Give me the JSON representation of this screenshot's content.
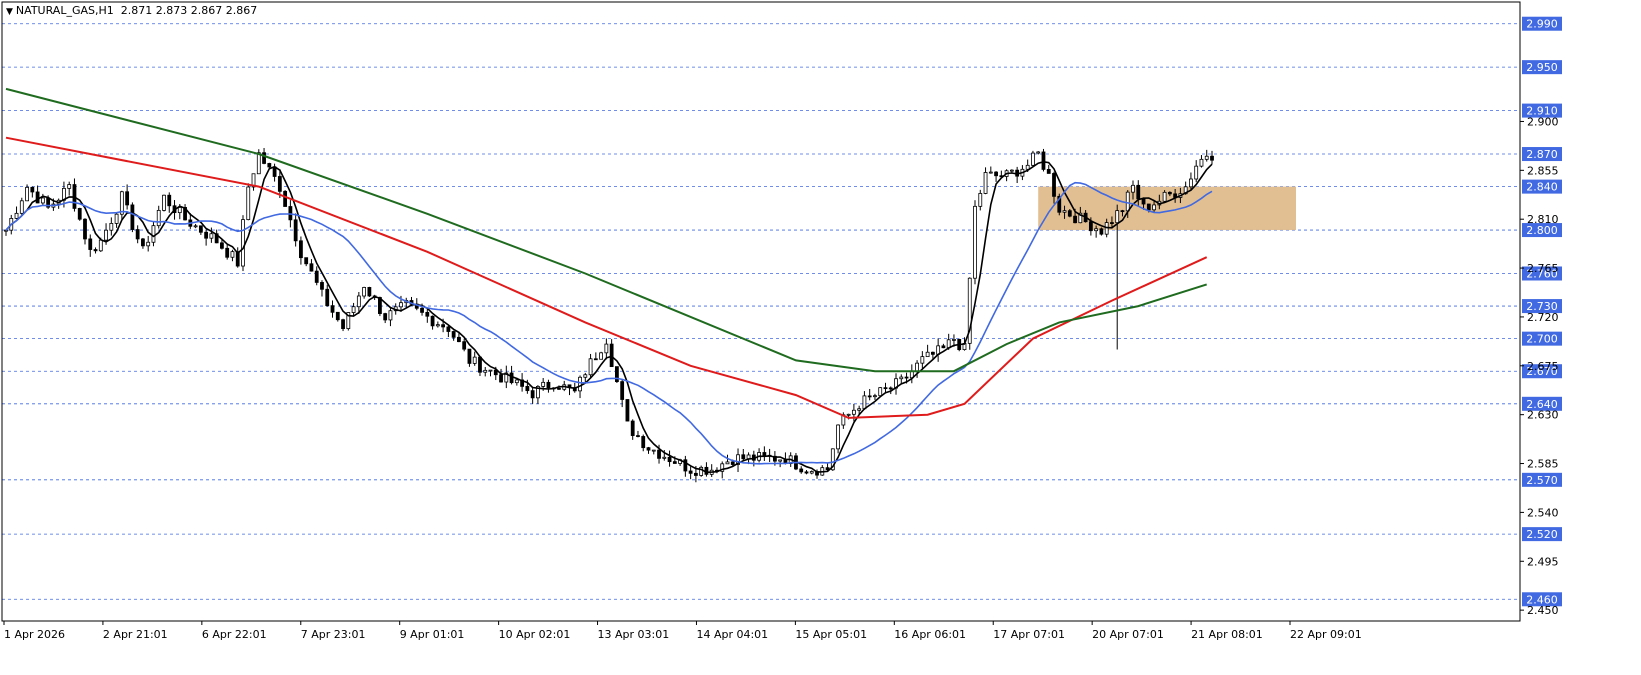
{
  "header": {
    "symbol": "NATURAL_GAS,H1",
    "ohlc": "2.871 2.873 2.867 2.867"
  },
  "chart_data": {
    "type": "candlestick",
    "ylim": [
      2.44,
      3.01
    ],
    "price_ticks": [
      "2.900",
      "2.855",
      "2.810",
      "2.765",
      "2.720",
      "2.675",
      "2.630",
      "2.585",
      "2.540",
      "2.495",
      "2.450"
    ],
    "time_labels": [
      "1 Apr 2026",
      "2 Apr 21:01",
      "6 Apr 22:01",
      "7 Apr 23:01",
      "9 Apr 01:01",
      "10 Apr 02:01",
      "13 Apr 03:01",
      "14 Apr 04:01",
      "15 Apr 05:01",
      "16 Apr 06:01",
      "17 Apr 07:01",
      "20 Apr 07:01",
      "21 Apr 08:01",
      "22 Apr 09:01"
    ],
    "level_lines": [
      2.99,
      2.95,
      2.91,
      2.87,
      2.84,
      2.8,
      2.76,
      2.73,
      2.7,
      2.67,
      2.64,
      2.57,
      2.52,
      2.46
    ],
    "level_labels": [
      "2.990",
      "2.950",
      "2.910",
      "2.870",
      "2.840",
      "2.800",
      "2.760",
      "2.730",
      "2.700",
      "2.670",
      "2.640",
      "2.570",
      "2.520",
      "2.460"
    ],
    "zone": {
      "from": 2.8,
      "to": 2.84,
      "start_label": "21 Apr 08:01",
      "color": "#deb887"
    },
    "price_path": [
      [
        0,
        2.8
      ],
      [
        4,
        2.84
      ],
      [
        8,
        2.82
      ],
      [
        12,
        2.84
      ],
      [
        16,
        2.78
      ],
      [
        18,
        2.79
      ],
      [
        22,
        2.83
      ],
      [
        26,
        2.78
      ],
      [
        30,
        2.83
      ],
      [
        34,
        2.81
      ],
      [
        40,
        2.79
      ],
      [
        44,
        2.77
      ],
      [
        46,
        2.84
      ],
      [
        48,
        2.87
      ],
      [
        52,
        2.84
      ],
      [
        56,
        2.78
      ],
      [
        60,
        2.74
      ],
      [
        64,
        2.71
      ],
      [
        68,
        2.75
      ],
      [
        72,
        2.72
      ],
      [
        76,
        2.73
      ],
      [
        80,
        2.72
      ],
      [
        84,
        2.71
      ],
      [
        88,
        2.68
      ],
      [
        92,
        2.67
      ],
      [
        96,
        2.66
      ],
      [
        100,
        2.65
      ],
      [
        104,
        2.66
      ],
      [
        108,
        2.65
      ],
      [
        110,
        2.67
      ],
      [
        114,
        2.7
      ],
      [
        118,
        2.62
      ],
      [
        122,
        2.6
      ],
      [
        126,
        2.59
      ],
      [
        130,
        2.58
      ],
      [
        134,
        2.58
      ],
      [
        138,
        2.59
      ],
      [
        142,
        2.59
      ],
      [
        148,
        2.59
      ],
      [
        152,
        2.58
      ],
      [
        156,
        2.58
      ],
      [
        158,
        2.62
      ],
      [
        162,
        2.64
      ],
      [
        166,
        2.65
      ],
      [
        170,
        2.66
      ],
      [
        174,
        2.68
      ],
      [
        178,
        2.69
      ],
      [
        180,
        2.7
      ],
      [
        182,
        2.69
      ],
      [
        184,
        2.82
      ],
      [
        186,
        2.85
      ],
      [
        190,
        2.85
      ],
      [
        194,
        2.86
      ],
      [
        196,
        2.87
      ],
      [
        198,
        2.85
      ],
      [
        200,
        2.82
      ],
      [
        204,
        2.81
      ],
      [
        208,
        2.8
      ],
      [
        212,
        2.82
      ],
      [
        214,
        2.84
      ],
      [
        216,
        2.82
      ],
      [
        220,
        2.83
      ],
      [
        224,
        2.84
      ],
      [
        226,
        2.86
      ],
      [
        228,
        2.87
      ]
    ],
    "spike_low": {
      "bar": 211,
      "value": 2.69
    },
    "bars": 230,
    "series": [
      {
        "name": "",
        "color": "#000000",
        "period": 5
      },
      {
        "name": "",
        "color": "#4169e1",
        "period": 20
      },
      {
        "name": "",
        "color": "#e01b1b",
        "period": 60
      },
      {
        "name": "",
        "color": "#1f6b1f",
        "period": 130
      }
    ],
    "series_seed": [
      {
        "color": "#e01b1b",
        "points": [
          [
            0,
            2.885
          ],
          [
            48,
            2.84
          ],
          [
            80,
            2.78
          ],
          [
            110,
            2.715
          ],
          [
            130,
            2.675
          ],
          [
            150,
            2.648
          ],
          [
            160,
            2.627
          ],
          [
            175,
            2.63
          ],
          [
            182,
            2.64
          ],
          [
            195,
            2.7
          ],
          [
            210,
            2.735
          ],
          [
            228,
            2.775
          ]
        ]
      },
      {
        "color": "#1f6b1f",
        "points": [
          [
            0,
            2.93
          ],
          [
            20,
            2.905
          ],
          [
            48,
            2.87
          ],
          [
            80,
            2.815
          ],
          [
            110,
            2.76
          ],
          [
            130,
            2.72
          ],
          [
            150,
            2.68
          ],
          [
            165,
            2.67
          ],
          [
            180,
            2.67
          ],
          [
            190,
            2.695
          ],
          [
            200,
            2.715
          ],
          [
            215,
            2.73
          ],
          [
            228,
            2.75
          ]
        ]
      }
    ]
  }
}
